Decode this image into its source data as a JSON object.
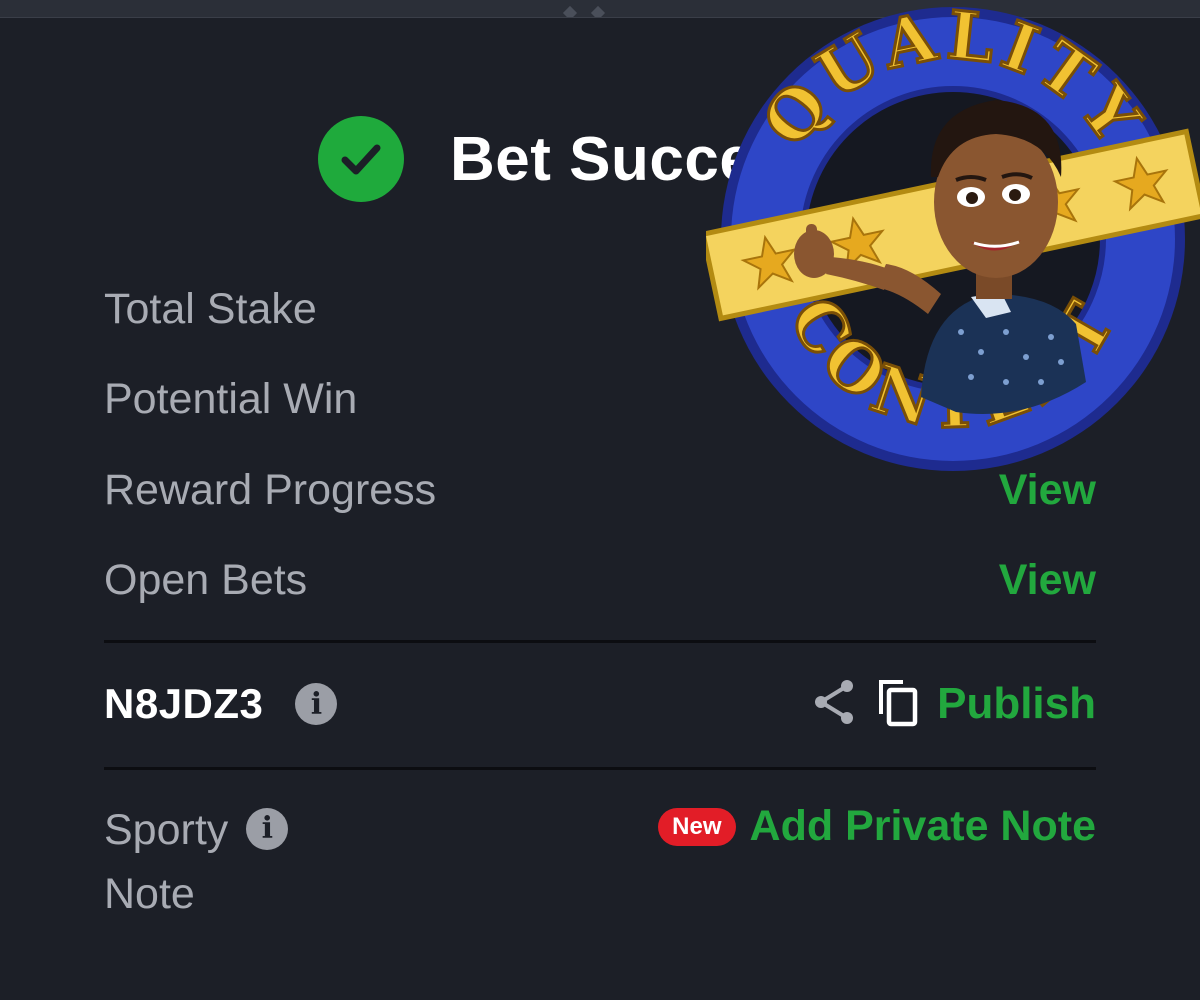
{
  "header": {
    "title": "Bet Successful"
  },
  "rows": [
    {
      "label": "Total Stake",
      "action": ""
    },
    {
      "label": "Potential Win",
      "action": ""
    },
    {
      "label": "Reward Progress",
      "action": "View"
    },
    {
      "label": "Open Bets",
      "action": "View"
    }
  ],
  "booking": {
    "code": "N8JDZ3",
    "publish_label": "Publish"
  },
  "note": {
    "label_line1": "Sporty",
    "label_line2": "Note",
    "badge": "New",
    "action": "Add Private Note"
  },
  "sticker": {
    "top_text": "QUALITY",
    "bottom_text": "CONTENT"
  },
  "colors": {
    "background": "#1c1f27",
    "accent_green": "#22a83e",
    "check_green": "#1faa3c",
    "badge_red": "#e21d27",
    "muted_text": "#a8abb3"
  },
  "icons": [
    "check-icon",
    "info-icon",
    "share-icon",
    "copy-icon"
  ]
}
